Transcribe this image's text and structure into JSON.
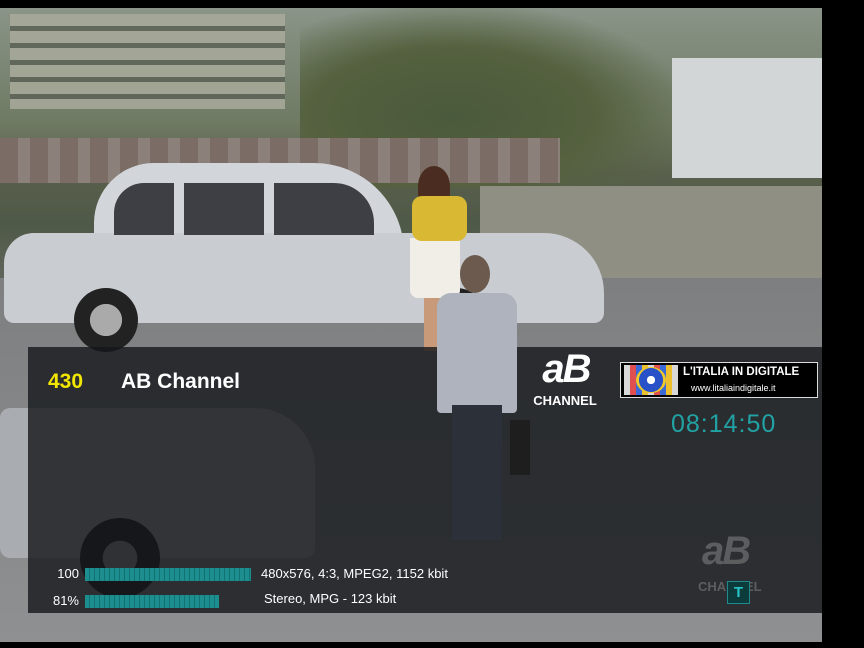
{
  "channel": {
    "number": "430",
    "name": "AB Channel",
    "logo_main": "aB",
    "logo_sub": "CHANNEL"
  },
  "banner": {
    "title": "L'ITALIA IN DIGITALE",
    "url": "www.litaliaindigitale.it"
  },
  "clock": "08:14:50",
  "signal": {
    "video": {
      "label": "100",
      "level_percent": 100,
      "info": "480x576, 4:3, MPEG2, 1152 kbit"
    },
    "audio": {
      "label": "81%",
      "level_percent": 81,
      "info": "Stereo, MPG - 123 kbit"
    }
  },
  "watermark": {
    "main": "aB",
    "sub": "CHANNEL"
  },
  "indicator": {
    "letter": "T"
  },
  "colors": {
    "channel_number": "#f2e600",
    "clock": "#21a3a5",
    "bar": "#1c8e90",
    "osd_background": "rgba(20,22,26,0.80)"
  }
}
